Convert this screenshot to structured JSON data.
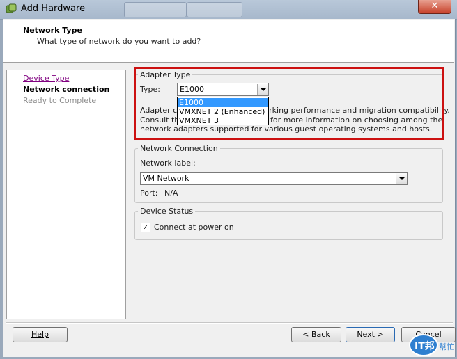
{
  "window": {
    "title": "Add Hardware",
    "close_symbol": "✕"
  },
  "header": {
    "title": "Network Type",
    "subtitle": "What type of network do you want to add?"
  },
  "steps": [
    {
      "label": "Device Type",
      "state": "link"
    },
    {
      "label": "Network connection",
      "state": "current"
    },
    {
      "label": "Ready to Complete",
      "state": "disabled"
    }
  ],
  "adapter": {
    "legend": "Adapter Type",
    "type_label": "Type:",
    "selected": "E1000",
    "options": [
      "E1000",
      "VMXNET 2 (Enhanced)",
      "VMXNET 3"
    ],
    "desc_line1_a": "Adapter ch",
    "desc_line1_b": "rking performance and migration compatibility.",
    "desc_line2_a": "Consult the",
    "desc_line2_b": "for more information on choosing among the",
    "desc_line3": "network adapters supported for various guest operating systems and hosts."
  },
  "network_connection": {
    "legend": "Network Connection",
    "label": "Network label:",
    "selected": "VM Network",
    "port_label": "Port:",
    "port_value": "N/A"
  },
  "device_status": {
    "legend": "Device Status",
    "connect_label": "Connect at power on",
    "connect_checked": true,
    "check_mark": "✓"
  },
  "footer": {
    "help": "Help",
    "back": "< Back",
    "next": "Next >",
    "cancel": "Cancel"
  },
  "watermark": {
    "text": "IT邦",
    "sub": "幫忙"
  },
  "colors": {
    "highlight_border": "#cc1111",
    "selection": "#3399ff"
  }
}
